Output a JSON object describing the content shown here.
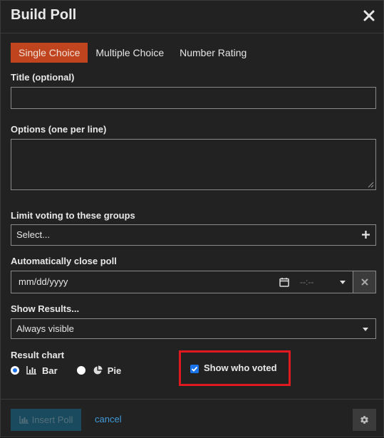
{
  "header": {
    "title": "Build Poll",
    "close_icon": "close-icon"
  },
  "tabs": [
    {
      "label": "Single Choice",
      "active": true
    },
    {
      "label": "Multiple Choice",
      "active": false
    },
    {
      "label": "Number Rating",
      "active": false
    }
  ],
  "title_field": {
    "label": "Title (optional)",
    "value": "",
    "placeholder": ""
  },
  "options_field": {
    "label": "Options (one per line)",
    "value": ""
  },
  "groups": {
    "label": "Limit voting to these groups",
    "placeholder": "Select...",
    "icon": "plus-icon"
  },
  "close_poll": {
    "label": "Automatically close poll",
    "date_placeholder": "mm/dd/yyyy",
    "time_placeholder": "--:--",
    "icons": [
      "calendar-icon",
      "clear-icon"
    ]
  },
  "show_results": {
    "label": "Show Results...",
    "selected": "Always visible"
  },
  "result_chart": {
    "label": "Result chart",
    "options": [
      {
        "label": "Bar",
        "icon": "bar-chart-icon",
        "checked": true
      },
      {
        "label": "Pie",
        "icon": "pie-chart-icon",
        "checked": false
      }
    ]
  },
  "show_who_voted": {
    "label": "Show who voted",
    "checked": true
  },
  "footer": {
    "insert_label": "Insert Poll",
    "cancel_label": "cancel",
    "icons": [
      "chart-icon",
      "gear-icon"
    ]
  },
  "colors": {
    "accent": "#c0451e",
    "checkbox": "#1a73e8",
    "highlight": "#e0181f",
    "link": "#3f9bd8",
    "background": "#222222"
  }
}
